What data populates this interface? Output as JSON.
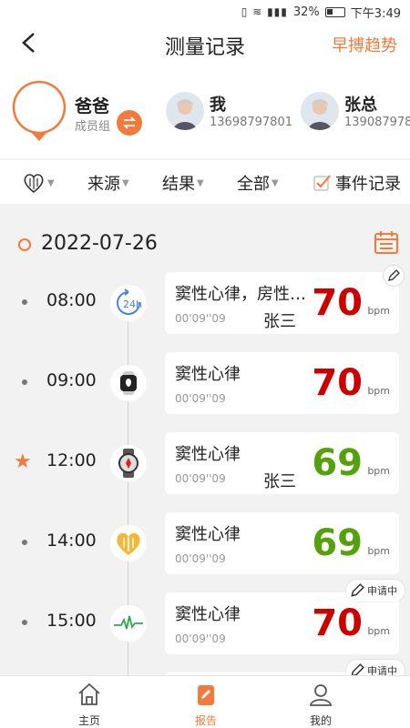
{
  "status_bar": {
    "battery": "32%",
    "time": "下午3:49"
  },
  "header": {
    "title": "测量记录",
    "trend_link": "早搏趋势"
  },
  "current_member": {
    "name": "爸爸",
    "group": "成员组"
  },
  "members": [
    {
      "name": "我",
      "phone": "13698797801"
    },
    {
      "name": "张总",
      "phone": "139087978"
    }
  ],
  "filters": {
    "device": "",
    "source": "来源",
    "result": "结果",
    "scope": "全部",
    "event_record": "事件记录"
  },
  "date": "2022-07-26",
  "records": [
    {
      "time": "08:00",
      "source_icon": "24h-recorder-icon",
      "result": "窦性心律，房性…",
      "duration": "00'09''09",
      "operator": "张三",
      "value": "70",
      "unit": "bpm",
      "status": "high",
      "starred": false,
      "badge": "edit"
    },
    {
      "time": "09:00",
      "source_icon": "apple-watch-icon",
      "result": "窦性心律",
      "duration": "00'09''09",
      "operator": "",
      "value": "70",
      "unit": "bpm",
      "status": "high",
      "starred": false,
      "badge": ""
    },
    {
      "time": "12:00",
      "source_icon": "huawei-watch-icon",
      "result": "窦性心律",
      "duration": "00'09''09",
      "operator": "张三",
      "value": "69",
      "unit": "bpm",
      "status": "normal",
      "starred": true,
      "badge": ""
    },
    {
      "time": "14:00",
      "source_icon": "heart-device-icon",
      "result": "窦性心律",
      "duration": "00'09''09",
      "operator": "",
      "value": "69",
      "unit": "bpm",
      "status": "normal",
      "starred": false,
      "badge": ""
    },
    {
      "time": "15:00",
      "source_icon": "ecg-wave-icon",
      "result": "窦性心律",
      "duration": "00'09''09",
      "operator": "",
      "value": "70",
      "unit": "bpm",
      "status": "high",
      "starred": false,
      "badge": "申请中"
    }
  ],
  "partial_badge": "申请中",
  "tabs": [
    {
      "label": "主页",
      "icon": "home-icon"
    },
    {
      "label": "报告",
      "icon": "report-icon"
    },
    {
      "label": "我的",
      "icon": "profile-icon"
    }
  ],
  "colors": {
    "accent": "#f07b3c",
    "high": "#cc0000",
    "normal": "#54a10c"
  }
}
